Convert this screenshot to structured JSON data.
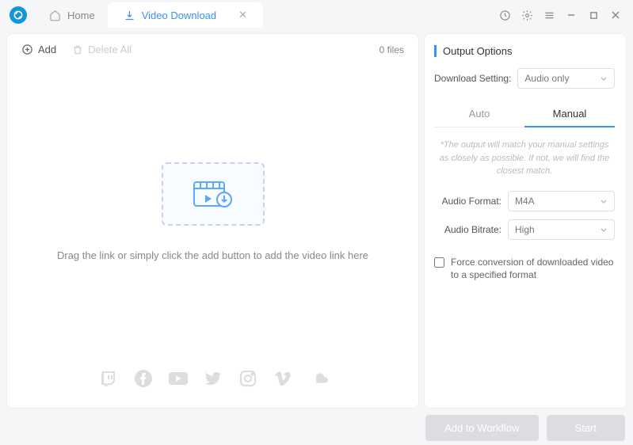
{
  "tabs": {
    "home": "Home",
    "download": "Video Download"
  },
  "toolbar": {
    "add": "Add",
    "delete_all": "Delete All",
    "file_count": "0 files"
  },
  "main": {
    "help_text": "Drag the link or simply click the add button to add the video link here"
  },
  "side": {
    "title": "Output Options",
    "download_setting_label": "Download Setting:",
    "download_setting_value": "Audio only",
    "tabs": {
      "auto": "Auto",
      "manual": "Manual"
    },
    "note": "*The output will match your manual settings as closely as possible. If not, we will find the closest match.",
    "audio_format_label": "Audio Format:",
    "audio_format_value": "M4A",
    "audio_bitrate_label": "Audio Bitrate:",
    "audio_bitrate_value": "High",
    "force_conversion": "Force conversion of downloaded video to a specified format"
  },
  "footer": {
    "workflow": "Add to Workflow",
    "start": "Start"
  }
}
